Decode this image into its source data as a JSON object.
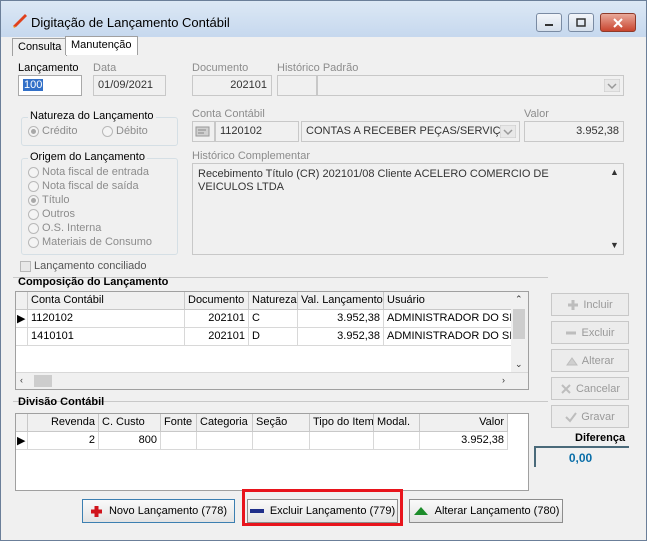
{
  "window": {
    "title": "Digitação de Lançamento Contábil"
  },
  "tabs": [
    {
      "label": "Consulta"
    },
    {
      "label": "Manutenção"
    }
  ],
  "fields": {
    "lancamento": {
      "label": "Lançamento",
      "value": "100"
    },
    "data": {
      "label": "Data",
      "value": "01/09/2021"
    },
    "documento": {
      "label": "Documento",
      "value": "202101"
    },
    "historico_padrao": {
      "label": "Histórico Padrão",
      "code": "",
      "value": ""
    },
    "conta_contabil": {
      "label": "Conta Contábil",
      "code": "1120102",
      "name": "CONTAS A RECEBER PEÇAS/SERVIÇOS"
    },
    "valor": {
      "label": "Valor",
      "value": "3.952,38"
    },
    "historico_complementar": {
      "label": "Histórico Complementar",
      "value": "Recebimento Título (CR) 202101/08 Cliente ACELERO COMERCIO DE VEICULOS LTDA"
    }
  },
  "natureza": {
    "title": "Natureza do Lançamento",
    "options": [
      {
        "label": "Crédito",
        "selected": true
      },
      {
        "label": "Débito",
        "selected": false
      }
    ]
  },
  "origem": {
    "title": "Origem do Lançamento",
    "options": [
      {
        "label": "Nota fiscal de entrada",
        "selected": false
      },
      {
        "label": "Nota fiscal de saída",
        "selected": false
      },
      {
        "label": "Título",
        "selected": true
      },
      {
        "label": "Outros",
        "selected": false
      },
      {
        "label": "O.S. Interna",
        "selected": false
      },
      {
        "label": "Materiais de Consumo",
        "selected": false
      }
    ]
  },
  "conciliado": {
    "label": "Lançamento conciliado",
    "checked": false
  },
  "composicao": {
    "title": "Composição do Lançamento",
    "headers": [
      "Conta Contábil",
      "Documento",
      "Natureza",
      "Val. Lançamento",
      "Usuário"
    ],
    "rows": [
      [
        "1120102",
        "202101",
        "C",
        "3.952,38",
        "ADMINISTRADOR DO SIST"
      ],
      [
        "1410101",
        "202101",
        "D",
        "3.952,38",
        "ADMINISTRADOR DO SIST"
      ]
    ]
  },
  "side_buttons": {
    "incluir": "Incluir",
    "excluir": "Excluir",
    "alterar": "Alterar",
    "cancelar": "Cancelar",
    "gravar": "Gravar"
  },
  "divisao": {
    "title": "Divisão Contábil",
    "headers": [
      "Revenda",
      "C. Custo",
      "Fonte",
      "Categoria",
      "Seção",
      "Tipo do Item",
      "Modal.",
      "Valor"
    ],
    "rows": [
      [
        "2",
        "800",
        "",
        "",
        "",
        "",
        "",
        "3.952,38"
      ]
    ]
  },
  "diferenca": {
    "label": "Diferença",
    "value": "0,00"
  },
  "bottom_buttons": {
    "novo": "Novo Lançamento (778)",
    "excluir": "Excluir Lançamento (779)",
    "alterar": "Alterar Lançamento (780)"
  },
  "colors": {
    "highlight_red": "#e8141c",
    "diferenca_value": "#0a6ea8",
    "novo_icon": "#d0141c",
    "excluir_icon": "#1f2f8a",
    "alterar_icon": "#1c8c2a"
  },
  "icons": [
    "app-icon",
    "minimize-icon",
    "maximize-icon",
    "close-icon",
    "plus-icon",
    "minus-icon",
    "triangle-up-icon"
  ]
}
